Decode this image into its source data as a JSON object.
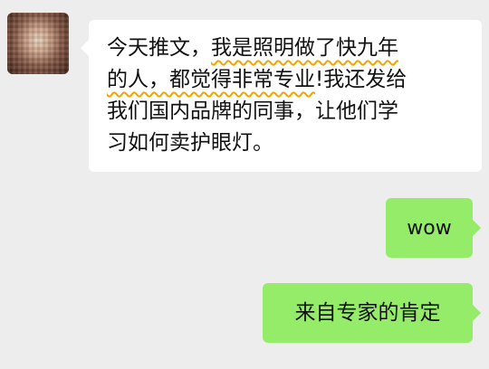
{
  "chat": {
    "incoming": {
      "avatar_icon": "avatar-photo",
      "lines": [
        {
          "plain": "今天推文，",
          "underlined": "我是照明做了快九年"
        },
        {
          "underlined": "的人，都觉得非常专业",
          "plain": "!我还发给"
        },
        {
          "plain": "我们国内品牌的同事，让他们学"
        },
        {
          "plain": "习如何卖护眼灯。"
        }
      ],
      "underline_color": "#f0a500"
    },
    "outgoing": [
      {
        "text": "wow"
      },
      {
        "text": "来自专家的肯定"
      }
    ],
    "colors": {
      "background": "#ededed",
      "incoming_bubble": "#ffffff",
      "outgoing_bubble": "#95ec69"
    }
  }
}
